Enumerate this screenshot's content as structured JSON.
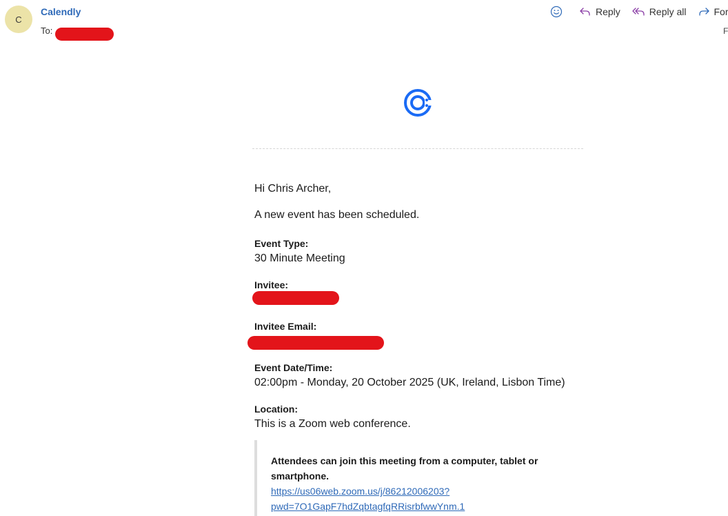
{
  "header": {
    "avatar_initial": "C",
    "sender_name": "Calendly",
    "to_label": "To:",
    "side_letter": "F"
  },
  "toolbar": {
    "reply_label": "Reply",
    "reply_all_label": "Reply all",
    "forward_label": "For"
  },
  "body": {
    "greeting": "Hi Chris Archer,",
    "intro": "A new event has been scheduled.",
    "event_type_label": "Event Type:",
    "event_type_value": "30 Minute Meeting",
    "invitee_label": "Invitee:",
    "invitee_email_label": "Invitee Email:",
    "event_datetime_label": "Event Date/Time:",
    "event_datetime_value": "02:00pm - Monday, 20 October 2025 (UK, Ireland, Lisbon Time)",
    "location_label": "Location:",
    "location_value": "This is a Zoom web conference."
  },
  "quote": {
    "title": "Attendees can join this meeting from a computer, tablet or smartphone.",
    "link_line1": "https://us06web.zoom.us/j/86212006203?",
    "link_line2": "pwd=7O1GapF7hdZqbtagfqRRisrbfwwYnm.1"
  },
  "colors": {
    "accent": "#2f6ab8",
    "avatar_bg": "#ece3a8",
    "redaction": "#e3141a",
    "calendly_blue": "#1a6bf5"
  }
}
